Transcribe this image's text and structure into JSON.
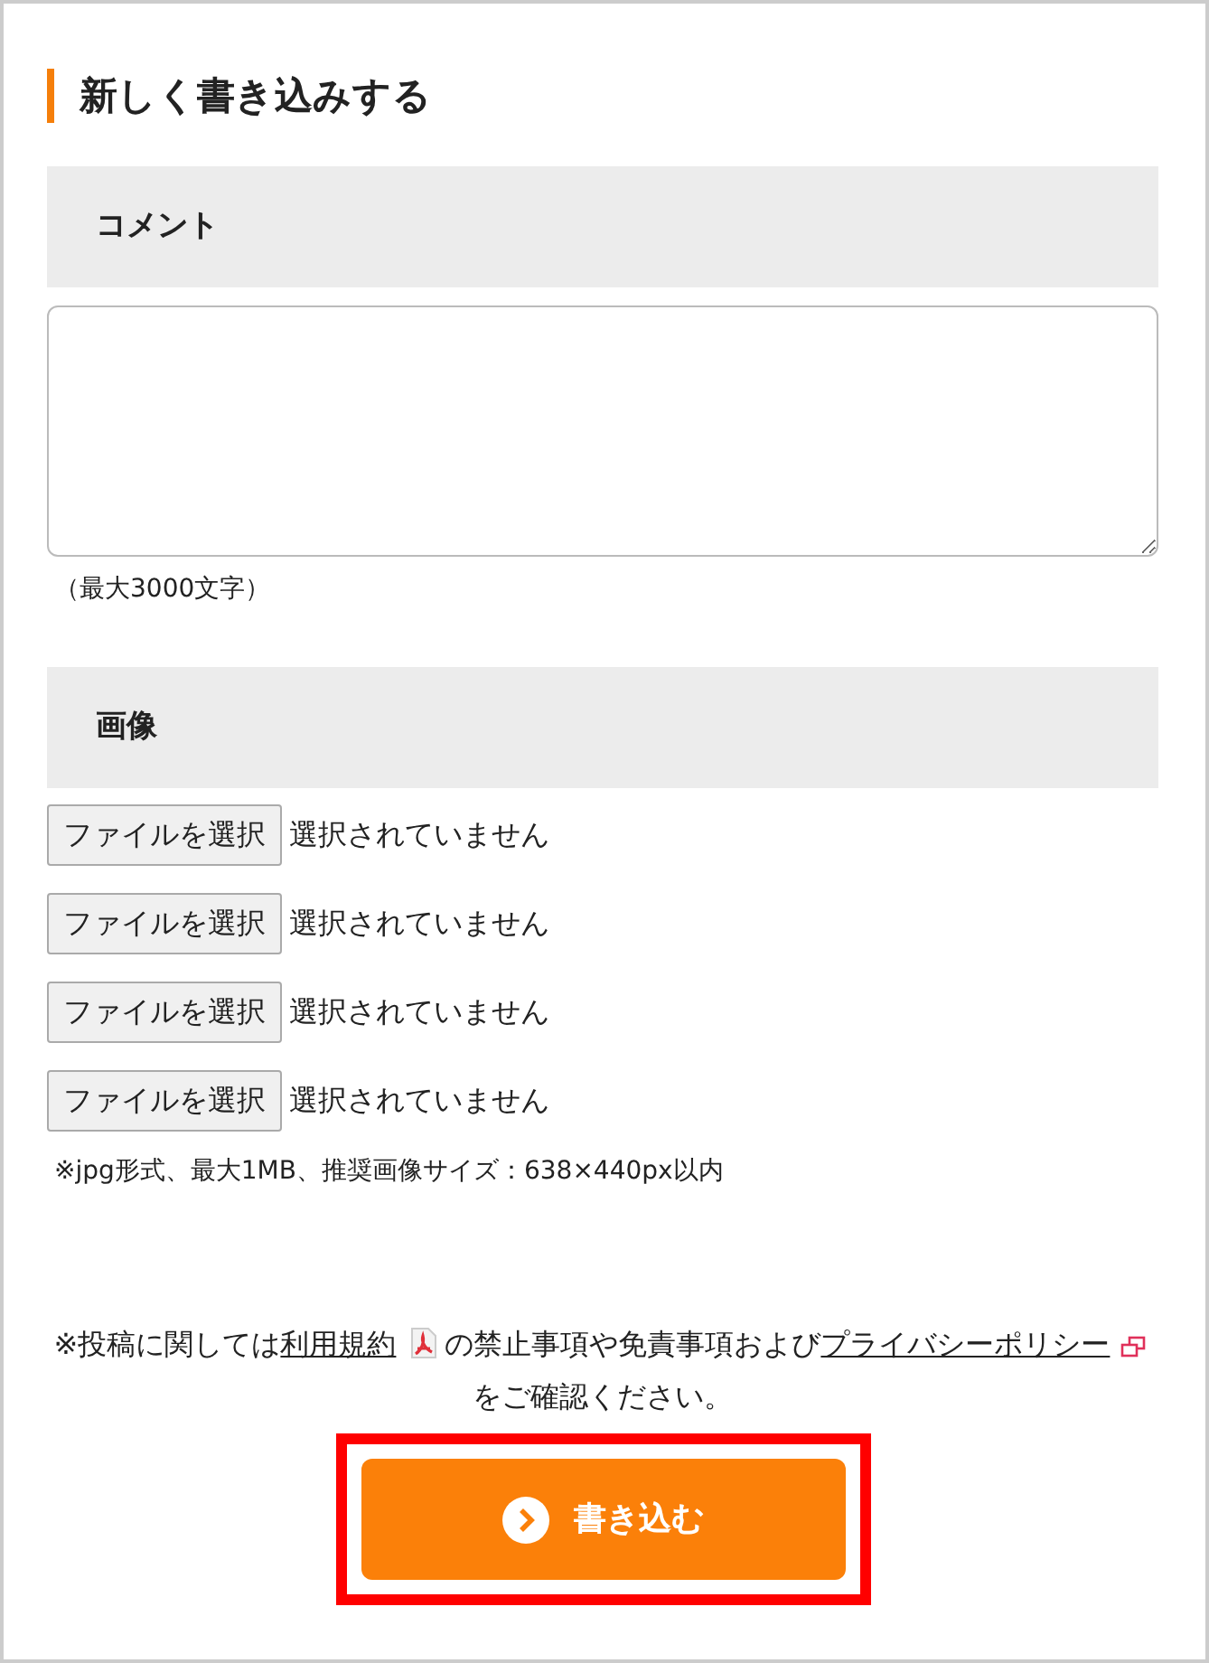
{
  "heading": "新しく書き込みする",
  "comment": {
    "label": "コメント",
    "note": "（最大3000文字）"
  },
  "image": {
    "label": "画像",
    "files": [
      {
        "button": "ファイルを選択",
        "status": "選択されていません"
      },
      {
        "button": "ファイルを選択",
        "status": "選択されていません"
      },
      {
        "button": "ファイルを選択",
        "status": "選択されていません"
      },
      {
        "button": "ファイルを選択",
        "status": "選択されていません"
      }
    ],
    "note": "※jpg形式、最大1MB、推奨画像サイズ：638×440px以内"
  },
  "notice": [
    {
      "kind": "text",
      "text": "※投稿に関しては"
    },
    {
      "kind": "pdf-link",
      "text": "利用規約"
    },
    {
      "kind": "text",
      "text": "の禁止事項や免責事項および"
    },
    {
      "kind": "external-link",
      "text": "プライバシーポリシー"
    },
    {
      "kind": "text",
      "text": "をご確認ください。"
    }
  ],
  "submit": {
    "label": "書き込む",
    "highlighted": true
  }
}
